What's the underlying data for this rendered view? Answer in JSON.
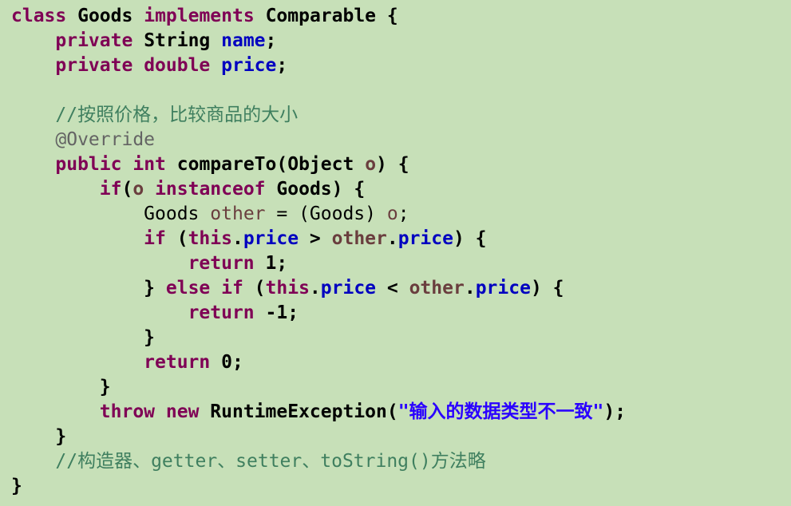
{
  "code": {
    "class_kw": "class",
    "class_name": "Goods",
    "implements_kw": "implements",
    "interface_name": "Comparable",
    "open_brace": "{",
    "private_kw": "private",
    "string_type": "String",
    "name_field": "name",
    "double_kw": "double",
    "price_field": "price",
    "semicolon": ";",
    "comment_compare": "//按照价格，比较商品的大小",
    "override_annotation": "@Override",
    "public_kw": "public",
    "int_kw": "int",
    "method_name": "compareTo(",
    "object_type": "Object",
    "param_o": "o",
    "method_sig_end": ") {",
    "if_kw": "if",
    "if_open": "(",
    "instanceof_kw": "instanceof",
    "goods_type": "Goods",
    "if_close": ") {",
    "other_var": "other",
    "cast_expr": " = (Goods) ",
    "if_paren": " (",
    "this_kw": "this",
    "dot": ".",
    "gt": " > ",
    "lt": " < ",
    "cond_close": ") {",
    "return_kw": "return",
    "ret_one": " 1;",
    "else_kw": "else",
    "close_else_prefix": "} ",
    "ret_neg_one": " -1;",
    "close_brace": "}",
    "ret_zero": " 0;",
    "throw_kw": "throw",
    "new_kw": "new",
    "runtime_exc": "RuntimeException(",
    "exc_message": "\"输入的数据类型不一致\"",
    "exc_end": ");",
    "comment_rest": "//构造器、getter、setter、toString()方法略"
  },
  "colors": {
    "background": "#c7e0b8",
    "keyword": "#7f0055",
    "field": "#0000c0",
    "variable": "#6a3e3e",
    "comment": "#3f7f5f",
    "annotation": "#646464",
    "string": "#2a00ff"
  }
}
